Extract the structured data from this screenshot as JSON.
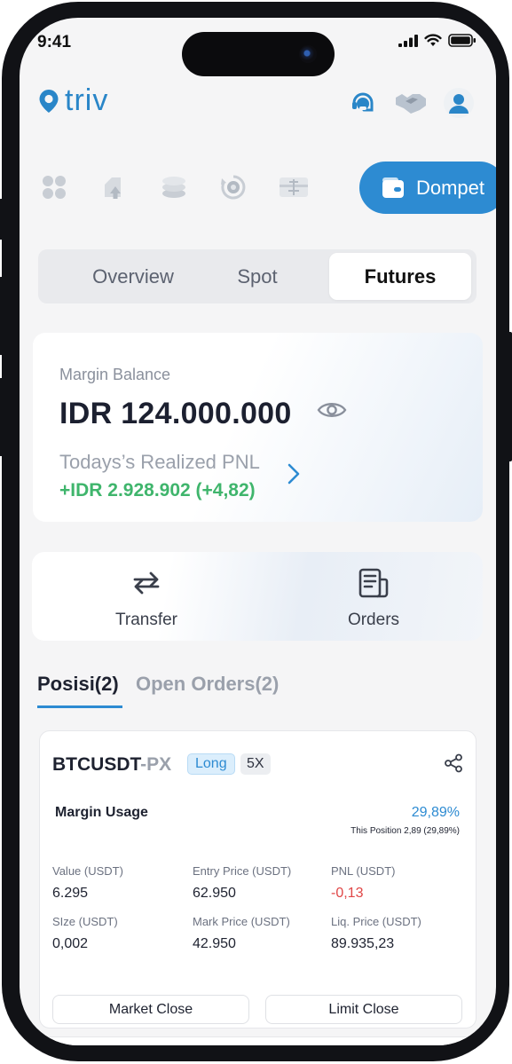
{
  "status": {
    "time": "9:41"
  },
  "brand": {
    "name": "triv",
    "accent": "#2d8bd2"
  },
  "header_icons": [
    "support-agent-icon",
    "handshake-icon",
    "user-avatar-icon"
  ],
  "quick_nav": {
    "items": [
      "grid-icon",
      "upload-icon",
      "coins-icon",
      "staking-icon",
      "tax-icon"
    ],
    "active_label": "Dompet"
  },
  "tabs": [
    {
      "label": "Overview"
    },
    {
      "label": "Spot"
    },
    {
      "label": "Futures",
      "active": true
    }
  ],
  "balance": {
    "label": "Margin Balance",
    "value": "IDR 124.000.000",
    "pnl_label": "Todays’s Realized PNL",
    "pnl_value": "+IDR 2.928.902 (+4,82)"
  },
  "actions": [
    {
      "label": "Transfer",
      "icon": "transfer-icon"
    },
    {
      "label": "Orders",
      "icon": "orders-icon"
    }
  ],
  "position_tabs": {
    "positions": "Posisi(2)",
    "open_orders": "Open Orders(2)"
  },
  "position": {
    "symbol": "BTCUSDT",
    "suffix": "-PX",
    "side": "Long",
    "leverage": "5X",
    "margin_usage_label": "Margin Usage",
    "margin_usage_value": "29,89%",
    "margin_usage_sub": "This Position 2,89 (29,89%)",
    "fields": [
      {
        "label": "Value (USDT)",
        "value": "6.295"
      },
      {
        "label": "Entry Price (USDT)",
        "value": "62.950"
      },
      {
        "label": "PNL (USDT)",
        "value": "-0,13",
        "negative": true
      },
      {
        "label": "SIze (USDT)",
        "value": "0,002"
      },
      {
        "label": "Mark Price (USDT)",
        "value": "42.950"
      },
      {
        "label": "Liq. Price (USDT)",
        "value": "89.935,23"
      }
    ],
    "market_close": "Market Close",
    "limit_close": "Limit Close"
  }
}
